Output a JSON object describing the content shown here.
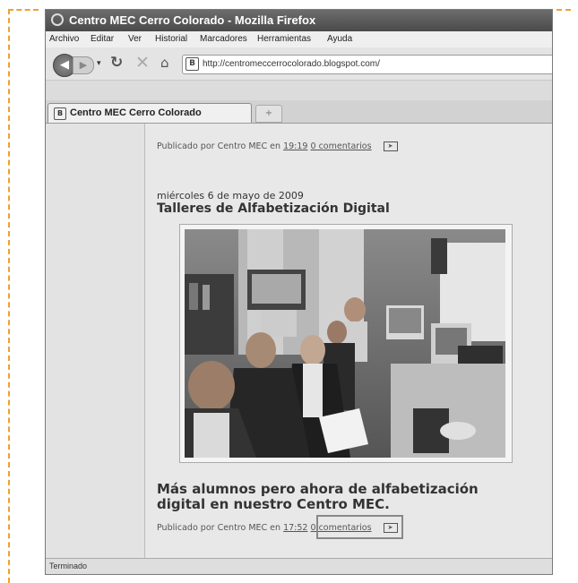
{
  "window": {
    "title": "Centro MEC Cerro Colorado - Mozilla Firefox"
  },
  "menu": [
    {
      "label": "Archivo"
    },
    {
      "label": "Editar"
    },
    {
      "label": "Ver"
    },
    {
      "label": "Historial"
    },
    {
      "label": "Marcadores"
    },
    {
      "label": "Herramientas"
    },
    {
      "label": "Ayuda"
    }
  ],
  "nav": {
    "url": "http://centromeccerrocolorado.blogspot.com/",
    "back_icon": "back-arrow-icon",
    "forward_icon": "forward-arrow-icon",
    "reload_icon": "reload-icon",
    "stop_icon": "stop-icon",
    "home_icon": "home-icon"
  },
  "tab": {
    "label": "Centro MEC Cerro Colorado"
  },
  "post1": {
    "meta_prefix": "Publicado por Centro MEC en",
    "time": "19:19",
    "comments": "0 comentarios"
  },
  "post2": {
    "date": "miércoles 6 de mayo de 2009",
    "title": "Talleres de Alfabetización Digital"
  },
  "post3": {
    "title": "Más alumnos pero ahora de alfabetización digital en nuestro Centro MEC.",
    "meta_prefix": "Publicado por Centro MEC en",
    "time": "17:52",
    "comments": "0 comentarios"
  },
  "status": {
    "text": "Terminado"
  }
}
